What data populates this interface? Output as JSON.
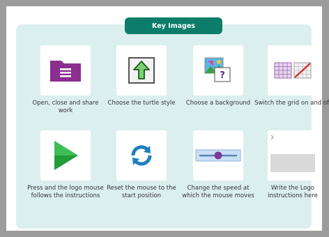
{
  "header": {
    "title": "Key Images"
  },
  "items": [
    {
      "caption": "Open, close and share work",
      "icon": "folder-menu-icon"
    },
    {
      "caption": "Choose the turtle style",
      "icon": "turtle-arrow-icon"
    },
    {
      "caption": "Choose a background",
      "icon": "background-picture-icon"
    },
    {
      "caption": "Switch the grid on and off",
      "icon": "grid-toggle-icon"
    },
    {
      "caption": "Press and the logo mouse follows the instructions",
      "icon": "play-icon"
    },
    {
      "caption": "Reset the mouse to the start position",
      "icon": "reset-icon"
    },
    {
      "caption": "Change the speed at which the mouse moves",
      "icon": "speed-slider-icon"
    },
    {
      "caption": "Write the Logo instructions here",
      "icon": "instructions-box-icon"
    }
  ],
  "colors": {
    "header": "#0b7d6a",
    "panel": "#dcefef",
    "folder": "#8a2f8f",
    "play": "#1f9e3a",
    "reset": "#1f7fc0",
    "slider_thumb": "#7b3a9a"
  }
}
